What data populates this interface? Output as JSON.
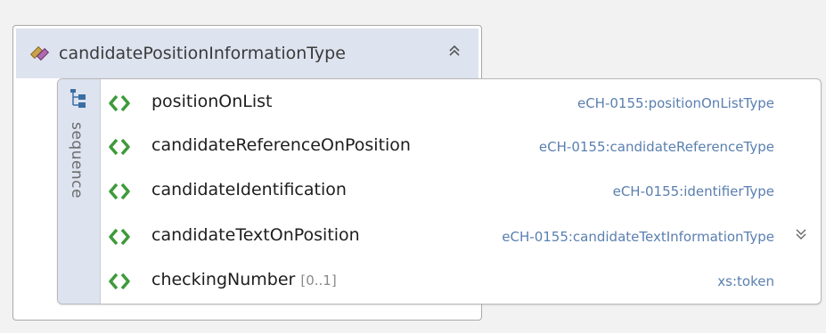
{
  "complex_type": {
    "name": "candidatePositionInformationType"
  },
  "sequence": {
    "label": "sequence",
    "elements": [
      {
        "name": "positionOnList",
        "occurs": "",
        "type": "eCH-0155:positionOnListType",
        "expandable": false
      },
      {
        "name": "candidateReferenceOnPosition",
        "occurs": "",
        "type": "eCH-0155:candidateReferenceType",
        "expandable": false
      },
      {
        "name": "candidateIdentification",
        "occurs": "",
        "type": "eCH-0155:identifierType",
        "expandable": false
      },
      {
        "name": "candidateTextOnPosition",
        "occurs": "",
        "type": "eCH-0155:candidateTextInformationType",
        "expandable": true
      },
      {
        "name": "checkingNumber",
        "occurs": "[0..1]",
        "type": "xs:token",
        "expandable": false
      }
    ]
  },
  "icons": {
    "header": "complex-type-icon",
    "collapse": "chevron-double-up-icon",
    "sequence": "sequence-icon",
    "element": "element-icon",
    "expand": "chevron-double-down-icon"
  },
  "colors": {
    "header_bg": "#dde3ef",
    "type_text": "#5a7fb0",
    "element_icon": "#3e9a3a"
  }
}
